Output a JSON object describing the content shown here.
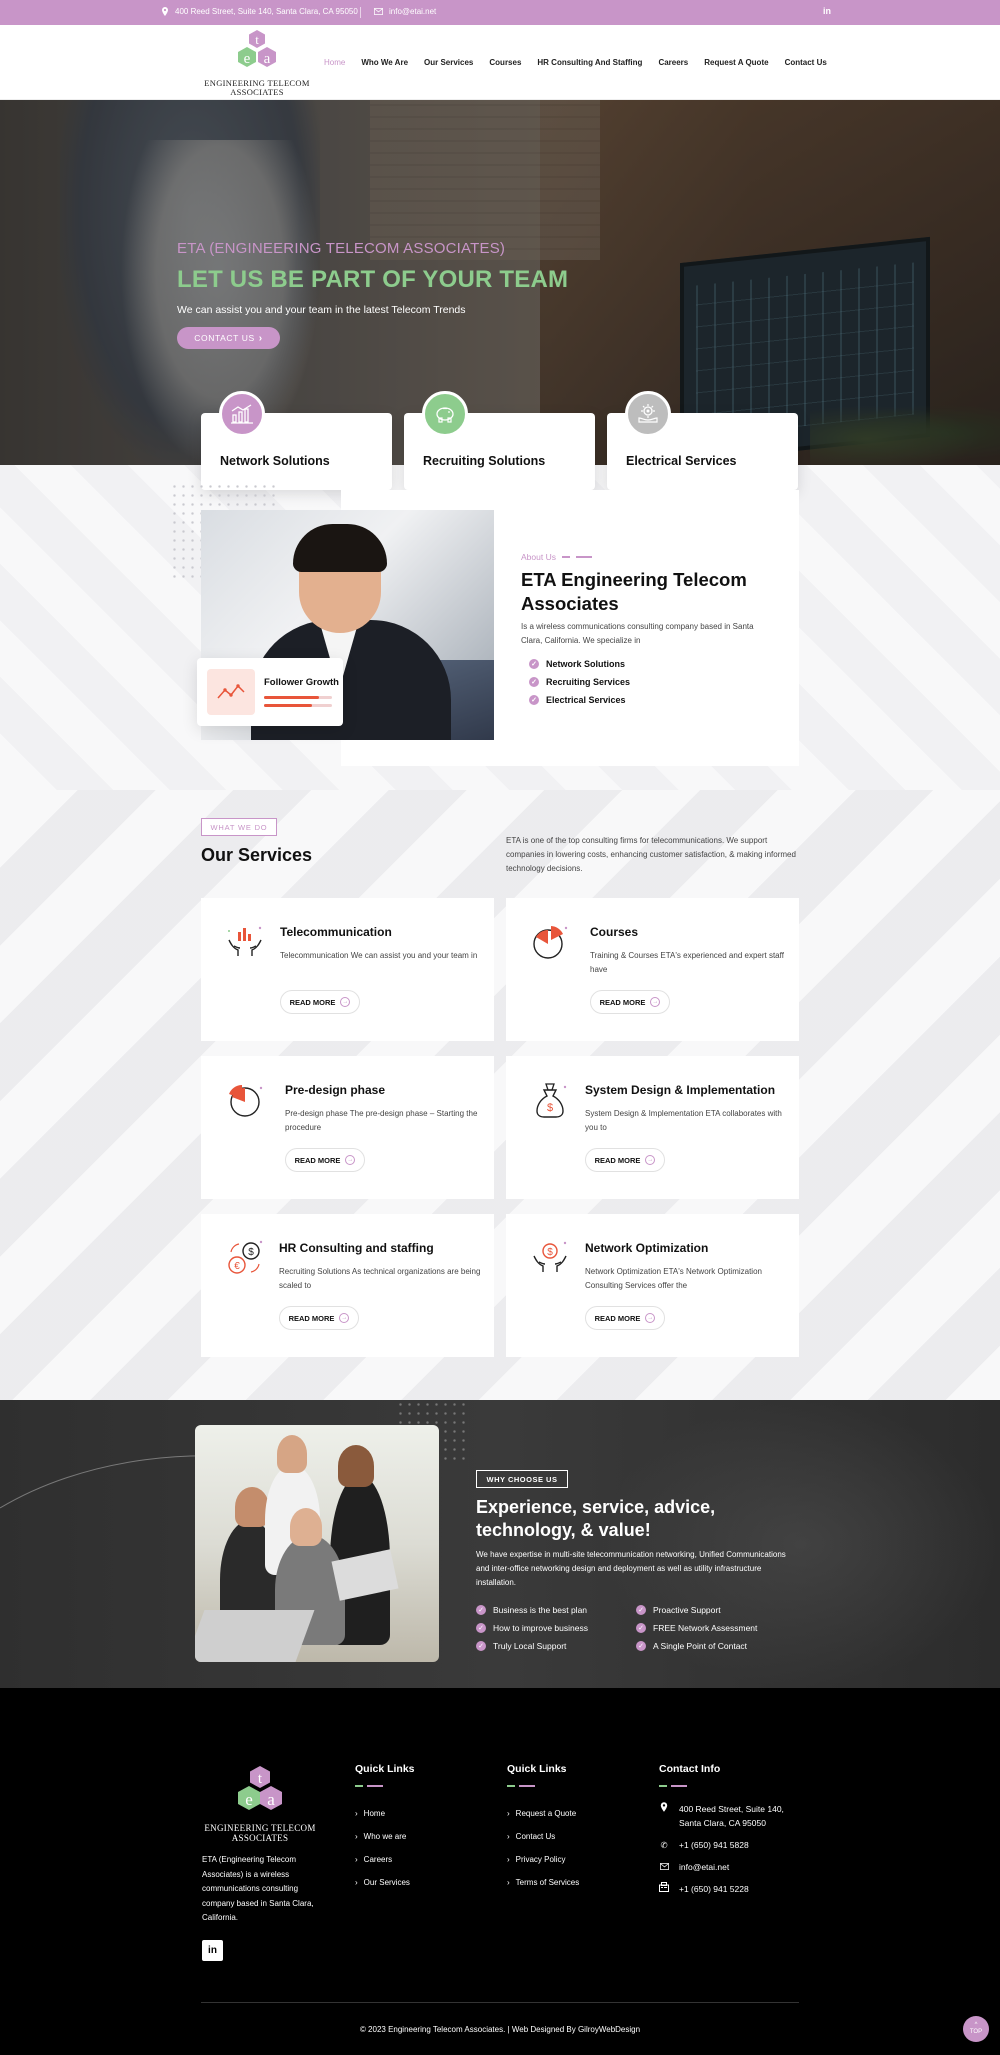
{
  "topbar": {
    "address": "400 Reed Street, Suite 140, Santa Clara, CA 95050",
    "email": "info@etai.net",
    "linkedin": "in"
  },
  "brand": {
    "logo_letters": [
      "t",
      "e",
      "a"
    ],
    "name_line1": "ENGINEERING TELECOM",
    "name_line2": "ASSOCIATES",
    "accent": "#c895c8",
    "green": "#8dcc8d"
  },
  "nav": {
    "items": [
      "Home",
      "Who We Are",
      "Our Services",
      "Courses",
      "HR Consulting And Staffing",
      "Careers",
      "Request A Quote",
      "Contact Us"
    ],
    "active": "Home"
  },
  "hero": {
    "subtitle": "ETA (ENGINEERING TELECOM ASSOCIATES)",
    "title": "LET US BE PART OF YOUR TEAM",
    "description": "We can assist you and your team in the latest Telecom Trends",
    "button": "CONTACT US"
  },
  "features": [
    {
      "label": "Network Solutions",
      "icon": "chart-icon",
      "color": "#c895c8"
    },
    {
      "label": "Recruiting Solutions",
      "icon": "piggy-bank-icon",
      "color": "#8dcc8d"
    },
    {
      "label": "Electrical Services",
      "icon": "gear-hand-icon",
      "color": "#bdbdbd"
    }
  ],
  "about": {
    "tag": "About Us",
    "title": "ETA Engineering Telecom Associates",
    "description": "Is a wireless communications consulting company based in Santa Clara, California. We specialize in",
    "list": [
      "Network Solutions",
      "Recruiting Services",
      "Electrical Services"
    ],
    "growth_label": "Follower Growth"
  },
  "services": {
    "tag": "WHAT WE DO",
    "title": "Our Services",
    "description": "ETA is one of the top consulting firms for telecommunications. We support companies in lowering costs, enhancing customer satisfaction, & making informed technology decisions.",
    "read_more": "READ MORE",
    "cards": [
      {
        "name": "Telecommunication",
        "text": "Telecommunication We can assist you and your team in",
        "icon": "hands-chart-icon"
      },
      {
        "name": "Courses",
        "text": "Training & Courses ETA's experienced and expert staff have",
        "icon": "pie-chart-icon"
      },
      {
        "name": "Pre-design phase",
        "text": "Pre-design phase The pre-design phase – Starting the procedure",
        "icon": "pie-chart-icon"
      },
      {
        "name": "System Design & Implementation",
        "text": "System Design & Implementation ETA collaborates with you to",
        "icon": "money-bag-icon"
      },
      {
        "name": "HR Consulting and staffing",
        "text": "Recruiting Solutions As technical organizations are being scaled to",
        "icon": "currency-exchange-icon"
      },
      {
        "name": "Network Optimization",
        "text": "Network Optimization ETA's Network Optimization Consulting Services offer the",
        "icon": "hands-dollar-icon"
      }
    ]
  },
  "why": {
    "tag": "WHY CHOOSE US",
    "title": "Experience, service, advice, technology, & value!",
    "description": "We have expertise in multi-site telecommunication networking, Unified Communications and inter-office networking design and deployment as well as utility infrastructure installation.",
    "col1": [
      "Business is the best plan",
      "How to improve business",
      "Truly Local Support"
    ],
    "col2": [
      "Proactive Support",
      "FREE Network Assessment",
      "A Single Point of Contact"
    ]
  },
  "footer": {
    "about": "ETA (Engineering Telecom Associates) is a wireless communications consulting company based in Santa Clara, California.",
    "linkedin": "in",
    "quick1_title": "Quick Links",
    "quick1": [
      "Home",
      "Who we are",
      "Careers",
      "Our Services"
    ],
    "quick2_title": "Quick Links",
    "quick2": [
      "Request a Quote",
      "Contact Us",
      "Privacy Policy",
      "Terms of Services"
    ],
    "contact_title": "Contact Info",
    "contact": {
      "address": "400 Reed Street, Suite 140, Santa Clara, CA 95050",
      "phone": "+1 (650) 941 5828",
      "email": "info@etai.net",
      "fax": "+1 (650) 941 5228"
    },
    "copyright": "© 2023 Engineering Telecom Associates. | Web Designed By GilroyWebDesign",
    "totop": "TOP"
  }
}
